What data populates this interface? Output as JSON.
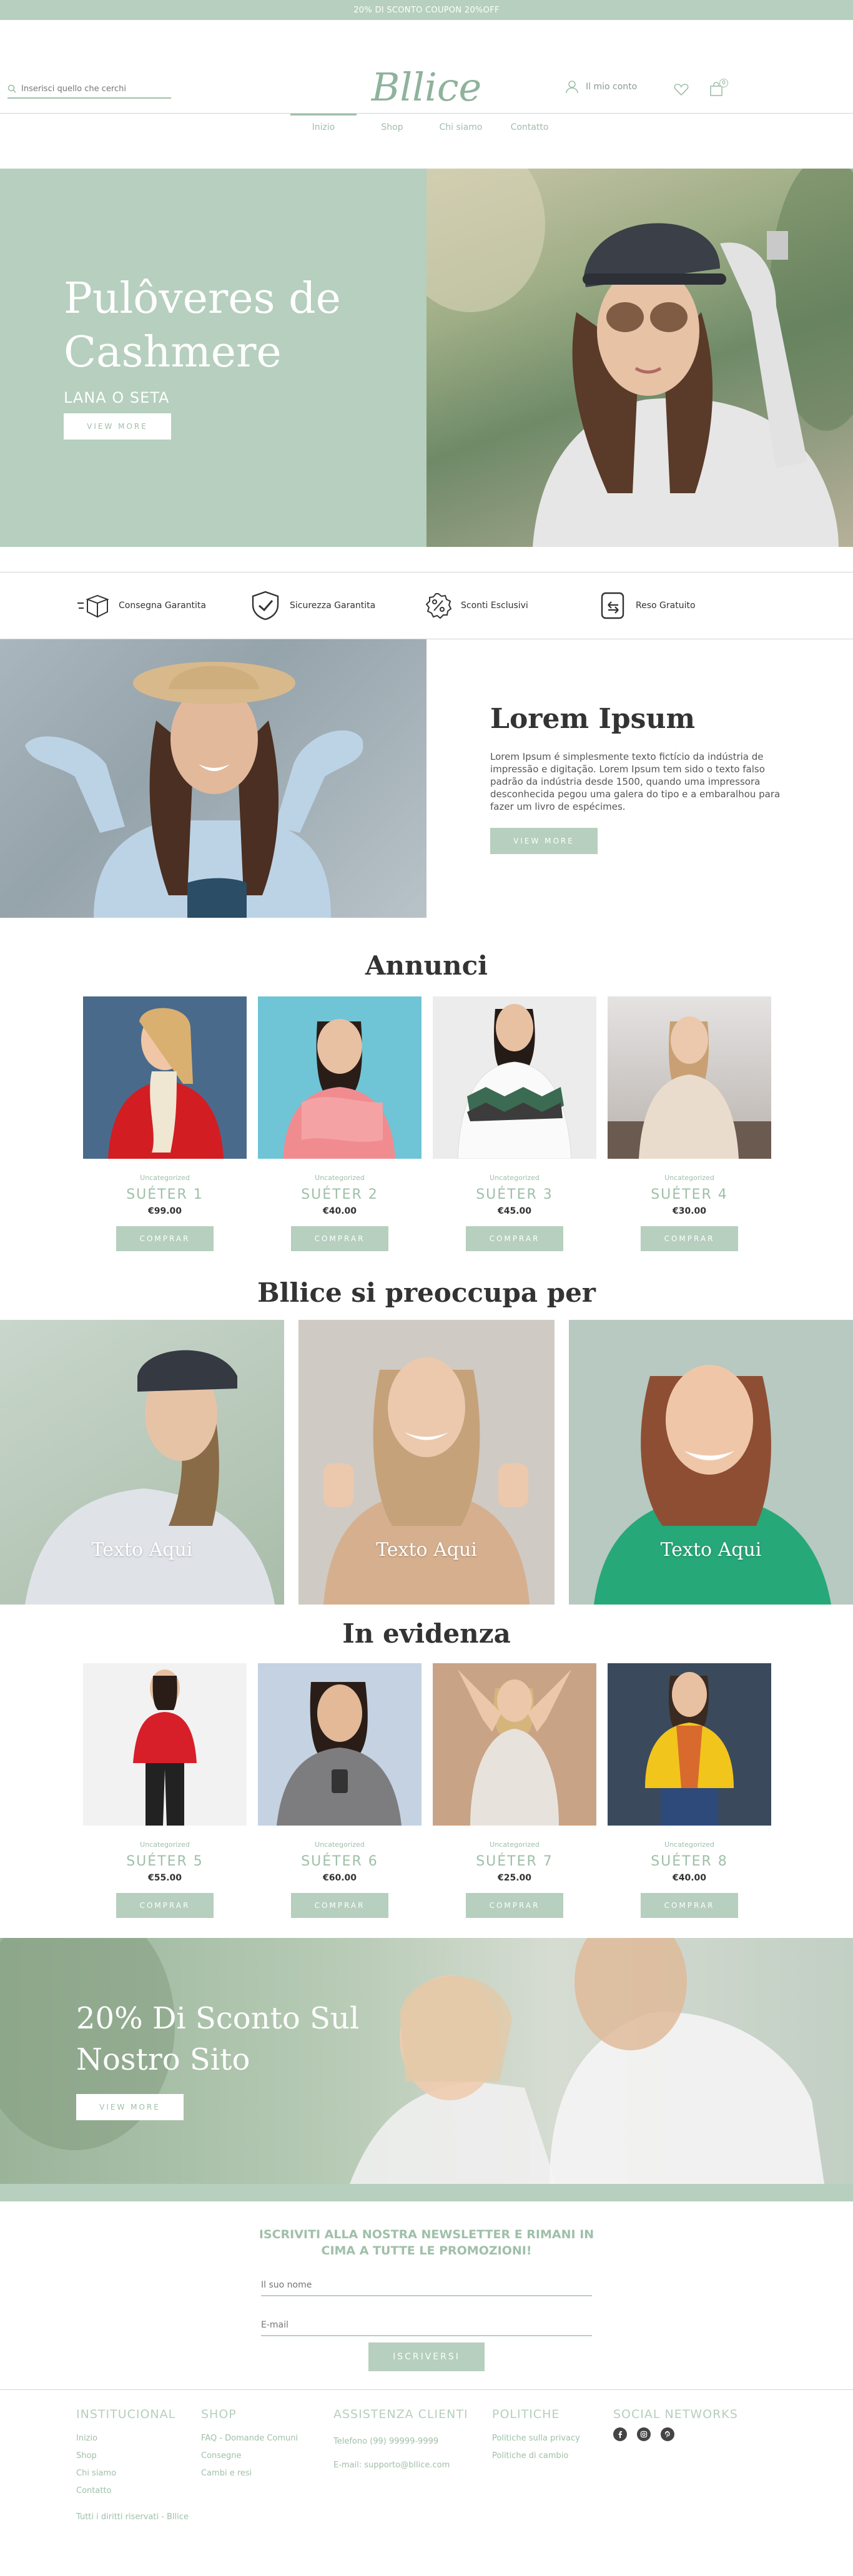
{
  "topbar": {
    "text": "20% DI SCONTO COUPON 20%OFF"
  },
  "header": {
    "search_placeholder": "Inserisci quello che cerchi",
    "logo": "Bllice",
    "account_label": "Il mio conto",
    "cart_count": "0"
  },
  "nav": {
    "items": [
      "Inizio",
      "Shop",
      "Chi siamo",
      "Contatto"
    ],
    "active": "Inizio"
  },
  "hero": {
    "title_line1": "Pulôveres de",
    "title_line2": "Cashmere",
    "subtitle": "LANA O SETA",
    "button": "VIEW MORE"
  },
  "features": [
    {
      "label": "Consegna Garantita",
      "icon": "box-icon"
    },
    {
      "label": "Sicurezza Garantita",
      "icon": "shield-check-icon"
    },
    {
      "label": "Sconti Esclusivi",
      "icon": "discount-icon"
    },
    {
      "label": "Reso Gratuito",
      "icon": "return-icon"
    }
  ],
  "about": {
    "title": "Lorem Ipsum",
    "body": "Lorem Ipsum é simplesmente texto fictício da indústria de impressão e digitação. Lorem Ipsum tem sido o texto falso padrão da indústria desde 1500, quando uma impressora desconhecida pegou uma galera do tipo e a embaralhou para fazer um livro de espécimes.",
    "button": "VIEW MORE"
  },
  "annunci": {
    "title": "Annunci",
    "products": [
      {
        "category": "Uncategorized",
        "name": "SUÉTER 1",
        "price": "€99.00",
        "button": "COMPRAR"
      },
      {
        "category": "Uncategorized",
        "name": "SUÉTER 2",
        "price": "€40.00",
        "button": "COMPRAR"
      },
      {
        "category": "Uncategorized",
        "name": "SUÉTER 3",
        "price": "€45.00",
        "button": "COMPRAR"
      },
      {
        "category": "Uncategorized",
        "name": "SUÉTER 4",
        "price": "€30.00",
        "button": "COMPRAR"
      }
    ]
  },
  "cares": {
    "title": "Bllice si preoccupa per",
    "items": [
      {
        "label": "Texto Aqui"
      },
      {
        "label": "Texto Aqui"
      },
      {
        "label": "Texto Aqui"
      }
    ]
  },
  "evidenza": {
    "title": "In evidenza",
    "products": [
      {
        "category": "Uncategorized",
        "name": "SUÉTER 5",
        "price": "€55.00",
        "button": "COMPRAR"
      },
      {
        "category": "Uncategorized",
        "name": "SUÉTER 6",
        "price": "€60.00",
        "button": "COMPRAR"
      },
      {
        "category": "Uncategorized",
        "name": "SUÉTER 7",
        "price": "€25.00",
        "button": "COMPRAR"
      },
      {
        "category": "Uncategorized",
        "name": "SUÉTER 8",
        "price": "€40.00",
        "button": "COMPRAR"
      }
    ]
  },
  "promo": {
    "title_line1": "20% Di Sconto Sul",
    "title_line2": "Nostro Sito",
    "button": "VIEW MORE"
  },
  "newsletter": {
    "title": "ISCRIVITI ALLA NOSTRA NEWSLETTER E RIMANI IN CIMA A TUTTE LE PROMOZIONI!",
    "name_placeholder": "Il suo nome",
    "email_placeholder": "E-mail",
    "button": "ISCRIVERSI"
  },
  "footer": {
    "col1": {
      "title": "INSTITUCIONAL",
      "links": [
        "Inizio",
        "Shop",
        "Chi siamo",
        "Contatto"
      ]
    },
    "col2": {
      "title": "SHOP",
      "links": [
        "FAQ - Domande Comuni",
        "Consegne",
        "Cambi e resi"
      ]
    },
    "col3": {
      "title": "ASSISTENZA CLIENTI",
      "links": [
        "Telefono (99) 99999-9999",
        "E-mail: supporto@bllice.com"
      ]
    },
    "col4": {
      "title": "POLITICHE",
      "links": [
        "Politiche sulla privacy",
        "Politiche di cambio"
      ]
    },
    "col5": {
      "title": "SOCIAL NETWORKS",
      "icons": [
        "facebook-icon",
        "instagram-icon",
        "pinterest-icon"
      ]
    },
    "copyright": "Tutti i diritti riservati - Bllice"
  },
  "colors": {
    "accent": "#b6cfbe",
    "accent_text": "#9fbfa9",
    "dark": "#333333"
  }
}
